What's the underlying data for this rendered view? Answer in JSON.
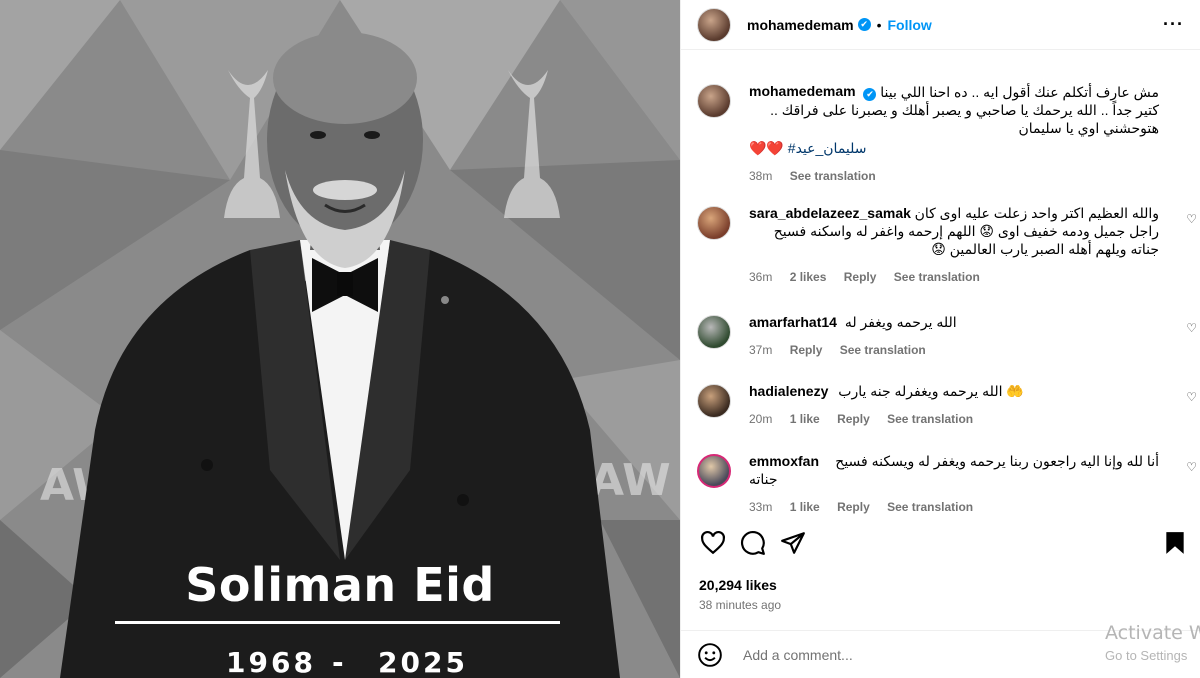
{
  "post_image": {
    "name_text": "Soliman Eid",
    "birth_year": "1968",
    "dash": "-",
    "death_year": "2025"
  },
  "header": {
    "username": "mohamedemam",
    "verified_mark": "✔",
    "separator": "•",
    "follow_label": "Follow",
    "more_label": "···"
  },
  "caption": {
    "username": "mohamedemam",
    "lines": [
      "مش عارف أتكلم عنك أقول ايه .. ده احنا اللي بينا",
      "كتير جداً .. الله يرحمك يا صاحبي و يصبر أهلك و يصبرنا على فراقك ..",
      "هتوحشني اوي يا سليمان"
    ],
    "hashtag": "#سليمان_عيد",
    "hearts": "❤️❤️",
    "time": "38m",
    "see_translation": "See translation"
  },
  "comments": [
    {
      "username": "sara_abdelazeez_samak",
      "lines": [
        "والله العظيم اكتر واحد زعلت عليه اوى كان",
        "راجل جميل ودمه خفيف اوى 😟 اللهم إرحمه واغفر له واسكنه فسيح",
        "جناته ويلهم أهله الصبر يارب العالمين 😟"
      ],
      "time": "36m",
      "likes": "2 likes",
      "reply": "Reply",
      "see_translation": "See translation"
    },
    {
      "username": "amarfarhat14",
      "lines": [
        "الله يرحمه ويغفر له"
      ],
      "time": "37m",
      "likes": "",
      "reply": "Reply",
      "see_translation": "See translation"
    },
    {
      "username": "hadialenezy",
      "lines": [
        "🤲 الله يرحمه ويغفرله جنه يارب"
      ],
      "time": "20m",
      "likes": "1 like",
      "reply": "Reply",
      "see_translation": "See translation"
    },
    {
      "username": "emmoxfan",
      "lines": [
        "أنا لله وإنا اليه راجعون ربنا يرحمه ويغفر له ويسكنه فسيح",
        "جناته"
      ],
      "time": "33m",
      "likes": "1 like",
      "reply": "Reply",
      "see_translation": "See translation"
    }
  ],
  "like_glyph": "♡",
  "footer": {
    "likes": "20,294 likes",
    "ago": "38 minutes ago",
    "add_comment_placeholder": "Add a comment..."
  },
  "watermark": {
    "line1": "Activate W",
    "line2": "Go to Settings"
  },
  "icons": [
    "heart-icon",
    "comment-icon",
    "share-icon",
    "bookmark-icon",
    "emoji-icon",
    "more-options-icon",
    "verified-badge-icon"
  ]
}
